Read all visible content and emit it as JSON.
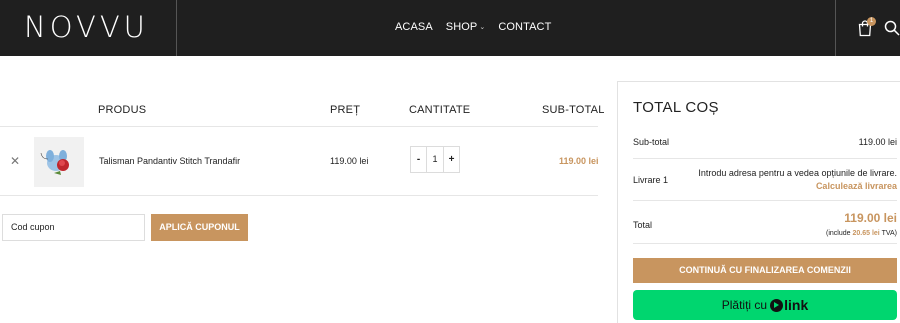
{
  "header": {
    "logo": "NOVVU",
    "nav": [
      {
        "label": "ACASA"
      },
      {
        "label": "SHOP",
        "has_dropdown": true
      },
      {
        "label": "CONTACT"
      }
    ],
    "cart_count": "1",
    "icons": [
      "shopping-bag-icon",
      "search-icon"
    ]
  },
  "cart": {
    "columns": {
      "product": "PRODUS",
      "price": "PREȚ",
      "quantity": "CANTITATE",
      "subtotal": "SUB-TOTAL"
    },
    "items": [
      {
        "name": "Talisman Pandantiv Stitch Trandafir",
        "price": "119.00 lei",
        "quantity": "1",
        "subtotal": "119.00 lei",
        "qty_minus": "-",
        "qty_plus": "+"
      }
    ],
    "coupon": {
      "placeholder": "Cod cupon",
      "button": "APLICĂ CUPONUL"
    }
  },
  "totals": {
    "title": "TOTAL COȘ",
    "subtotal_label": "Sub-total",
    "subtotal_value": "119.00 lei",
    "shipping_label": "Livrare 1",
    "shipping_text": "Introdu adresa pentru a vedea opțiunile de livrare.",
    "shipping_link": "Calculează livrarea",
    "total_label": "Total",
    "total_value": "119.00 lei",
    "vat_prefix": "(include ",
    "vat_amount": "20.65 lei",
    "vat_suffix": " TVA)",
    "checkout_button": "CONTINUĂ CU FINALIZAREA COMENZII",
    "link_pay_text": "Plătiți cu",
    "link_brand": "link"
  },
  "colors": {
    "header_bg": "#1f1f1f",
    "accent": "#c8955f",
    "link_green": "#00d66f"
  }
}
